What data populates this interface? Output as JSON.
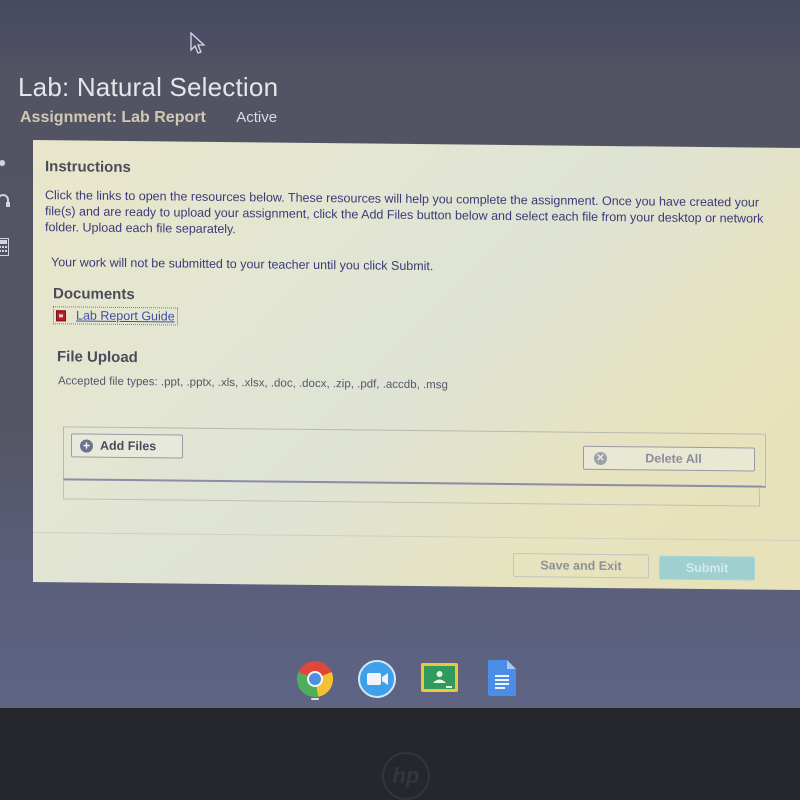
{
  "header": {
    "title": "Lab: Natural Selection",
    "assignment": "Assignment: Lab Report",
    "status": "Active"
  },
  "side_rail": {
    "icons": [
      "dot-icon",
      "headphones-icon",
      "calculator-icon"
    ]
  },
  "instructions": {
    "heading": "Instructions",
    "body": "Click the links to open the resources below. These resources will help you complete the assignment. Once you have created your file(s) and are ready to upload your assignment, click the Add Files button below and select each file from your desktop or network folder. Upload each file separately.",
    "notice": "Your work will not be submitted to your teacher until you click Submit."
  },
  "documents": {
    "heading": "Documents",
    "items": [
      {
        "label": "Lab Report Guide",
        "icon": "pdf-icon"
      }
    ]
  },
  "file_upload": {
    "heading": "File Upload",
    "accepted_types": "Accepted file types: .ppt, .pptx, .xls, .xlsx, .doc, .docx, .zip, .pdf, .accdb, .msg",
    "add_files_label": "Add Files",
    "delete_all_label": "Delete All"
  },
  "footer": {
    "save_exit_label": "Save and Exit",
    "submit_label": "Submit"
  },
  "shelf": {
    "apps": [
      {
        "name": "Chrome",
        "active": true
      },
      {
        "name": "Zoom",
        "active": false
      },
      {
        "name": "Google Classroom",
        "active": false
      },
      {
        "name": "Google Docs",
        "active": false
      }
    ]
  },
  "device": {
    "logo": "hp"
  },
  "colors": {
    "submit_bg": "#9fd0cf",
    "link": "#3d4ea8",
    "pdf": "#b81e28"
  }
}
